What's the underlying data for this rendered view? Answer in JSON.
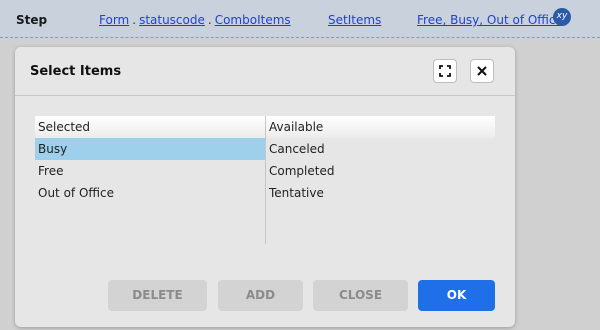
{
  "stepbar": {
    "label": "Step",
    "crumbs": [
      {
        "text": "Form"
      },
      {
        "text": "statuscode"
      },
      {
        "text": "ComboItems"
      }
    ],
    "separator": ".",
    "method": "SetItems",
    "args": "Free, Busy, Out of Office",
    "badge_text": "xy"
  },
  "dialog": {
    "title": "Select Items",
    "selected_list": {
      "header": "Selected",
      "items": [
        "Busy",
        "Free",
        "Out of Office"
      ],
      "highlighted": "Busy"
    },
    "available_list": {
      "header": "Available",
      "items": [
        "Canceled",
        "Completed",
        "Tentative"
      ]
    },
    "buttons": {
      "delete": "DELETE",
      "add": "ADD",
      "close": "CLOSE",
      "ok": "OK"
    },
    "colors": {
      "ok_button": "#1f6fe8",
      "selection": "#9ed0eb"
    }
  }
}
